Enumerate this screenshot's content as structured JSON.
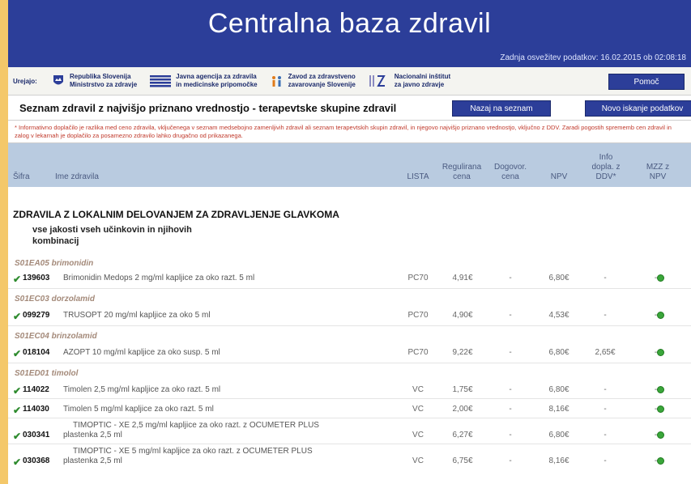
{
  "header": {
    "title": "Centralna baza zdravil",
    "last_update": "Zadnja osvežitev podatkov: 16.02.2015 ob 02:08:18"
  },
  "ustanove": {
    "label": "Urejajo:",
    "items": [
      {
        "line1": "Republika Slovenija",
        "line2": "Ministrstvo za zdravje",
        "icon": "shield-icon"
      },
      {
        "line1": "Javna agencija za zdravila",
        "line2": "in medicinske pripomočke",
        "icon": "stripes-icon"
      },
      {
        "line1": "Zavod za zdravstveno",
        "line2": "zavarovanje Slovenije",
        "icon": "people-icon"
      },
      {
        "line1": "Nacionalni inštitut",
        "line2": "za javno zdravje",
        "icon": "nijz-logo"
      }
    ],
    "pomoc": "Pomoč"
  },
  "toolbar": {
    "title": "Seznam zdravil z najvišjo priznano vrednostjo - terapevtske skupine zdravil",
    "back": "Nazaj na seznam",
    "new_search": "Novo iskanje podatkov"
  },
  "note": "* Informativno doplačilo je razlika med ceno zdravila, vključenega v seznam medsebojno zamenljivih zdravil ali seznam terapevtskih skupin zdravil, in njegovo najvišjo priznano vrednostjo, vključno z DDV. Zaradi pogostih sprememb cen zdravil in zalog v lekarnah je doplačilo za posamezno zdravilo lahko drugačno od prikazanega.",
  "columns": {
    "sifra": "Šifra",
    "ime": "Ime zdravila",
    "lista": "LISTA",
    "reg_cena_1": "Regulirana",
    "reg_cena_2": "cena",
    "dog_cena_1": "Dogovor.",
    "dog_cena_2": "cena",
    "npv": "NPV",
    "info_1": "Info",
    "info_2": "dopla. z",
    "info_3": "DDV*",
    "mzz_1": "MZZ z",
    "mzz_2": "NPV"
  },
  "group": {
    "title": "ZDRAVILA Z LOKALNIM DELOVANJEM ZA ZDRAVLJENJE GLAVKOMA",
    "sub1": "vse jakosti vseh učinkovin in njihovih",
    "sub2": "kombinacij"
  },
  "atc": [
    "S01EA05 brimonidin",
    "S01EC03 dorzolamid",
    "S01EC04 brinzolamid",
    "S01ED01 timolol"
  ],
  "rows": [
    {
      "sifra": "139603",
      "ime": "Brimonidin Medops 2 mg/ml kapljice za oko razt. 5 ml",
      "ime2": "",
      "lista": "PC70",
      "reg": "4,91€",
      "dog": "-",
      "npv": "6,80€",
      "info": "-",
      "mzz": "-"
    },
    {
      "sifra": "099279",
      "ime": "TRUSOPT 20 mg/ml kapljice za oko 5 ml",
      "ime2": "",
      "lista": "PC70",
      "reg": "4,90€",
      "dog": "-",
      "npv": "4,53€",
      "info": "-",
      "mzz": "-"
    },
    {
      "sifra": "018104",
      "ime": "AZOPT 10 mg/ml kapljice za oko susp. 5 ml",
      "ime2": "",
      "lista": "PC70",
      "reg": "9,22€",
      "dog": "-",
      "npv": "6,80€",
      "info": "2,65€",
      "mzz": "-"
    },
    {
      "sifra": "114022",
      "ime": "Timolen 2,5 mg/ml kapljice za oko razt. 5 ml",
      "ime2": "",
      "lista": "VC",
      "reg": "1,75€",
      "dog": "-",
      "npv": "6,80€",
      "info": "-",
      "mzz": "-"
    },
    {
      "sifra": "114030",
      "ime": "Timolen 5 mg/ml kapljice za oko razt. 5 ml",
      "ime2": "",
      "lista": "VC",
      "reg": "2,00€",
      "dog": "-",
      "npv": "8,16€",
      "info": "-",
      "mzz": "-"
    },
    {
      "sifra": "030341",
      "ime": "TIMOPTIC - XE 2,5 mg/ml kapljice za oko razt. z OCUMETER PLUS",
      "ime2": "plastenka 2,5 ml",
      "lista": "VC",
      "reg": "6,27€",
      "dog": "-",
      "npv": "6,80€",
      "info": "-",
      "mzz": "-"
    },
    {
      "sifra": "030368",
      "ime": "TIMOPTIC - XE 5 mg/ml kapljice za oko razt. z OCUMETER PLUS",
      "ime2": "plastenka 2,5 ml",
      "lista": "VC",
      "reg": "6,75€",
      "dog": "-",
      "npv": "8,16€",
      "info": "-",
      "mzz": "-"
    }
  ],
  "colors": {
    "header": "#2c3e99",
    "table_head": "#b9cbe0",
    "check": "#2e8b2e",
    "note": "#c0392b"
  }
}
